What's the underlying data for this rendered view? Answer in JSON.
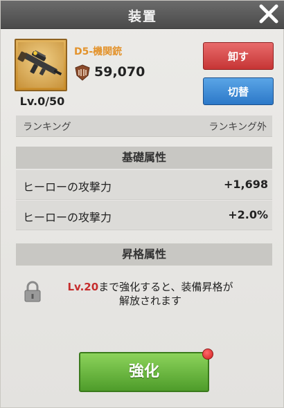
{
  "header": {
    "title": "装置"
  },
  "item": {
    "name": "D5-機関銃",
    "level": "Lv.0/50",
    "power": "59,070",
    "icon": "machine-gun-icon"
  },
  "buttons": {
    "unequip": "卸す",
    "switch": "切替",
    "enhance": "強化"
  },
  "ranking": {
    "label": "ランキング",
    "value": "ランキング外"
  },
  "base_attributes": {
    "heading": "基礎属性",
    "rows": [
      {
        "label": "ヒーローの攻撃力",
        "value": "+1,698"
      },
      {
        "label": "ヒーローの攻撃力",
        "value": "+2.0%"
      }
    ]
  },
  "upgrade_attributes": {
    "heading": "昇格属性",
    "notice_level": "Lv.20",
    "notice_line1": "まで強化すると、装備昇格が",
    "notice_line2": "解放されます"
  },
  "colors": {
    "enhance": "#5fae33",
    "unequip": "#d84848",
    "switch": "#3a88d6",
    "item_name": "#e3932c"
  }
}
